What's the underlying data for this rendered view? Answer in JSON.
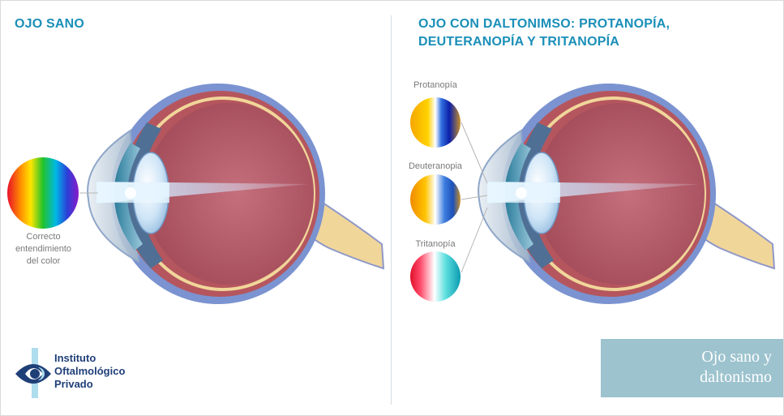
{
  "left_panel": {
    "title": "OJO SANO",
    "caption": [
      "Correcto",
      "entendimiento",
      "del color"
    ]
  },
  "right_panel": {
    "title": "OJO CON DALTONIMSO: PROTANOPÍA, DEUTERANOPÍA Y TRITANOPÍA",
    "labels": {
      "protanopia": "Protanopía",
      "deuteranopia": "Deuteranopia",
      "tritanopia": "Tritanopía"
    }
  },
  "logo": {
    "lines": [
      "Instituto",
      "Oftalmológico",
      "Privado"
    ]
  },
  "badge": {
    "lines": [
      "Ojo sano y",
      "daltonismo"
    ]
  },
  "colors": {
    "title": "#1a8fb8",
    "badge_bg": "#9cc3ce",
    "logo_text": "#1f3f77",
    "sclera_outer": "#7b93d0",
    "choroid": "#b5565e",
    "vitreous": "#b75a66",
    "optic_nerve": "#f1d69a"
  },
  "icons": {
    "logo": "eye-logo-icon",
    "spectrum_normal": "full-spectrum-circle",
    "spectrum_protanopia": "protanopia-spectrum-circle",
    "spectrum_deuteranopia": "deuteranopia-spectrum-circle",
    "spectrum_tritanopia": "tritanopia-spectrum-circle"
  }
}
